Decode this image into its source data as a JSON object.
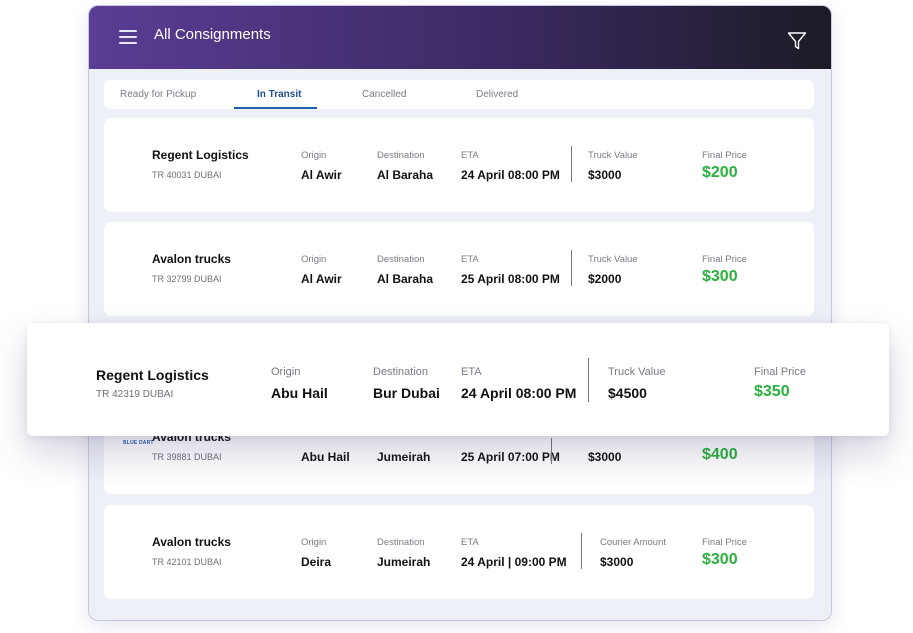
{
  "header": {
    "title": "All Consignments"
  },
  "tabs": [
    "Ready for Pickup",
    "In Transit",
    "Cancelled",
    "Delivered"
  ],
  "active_tab": "In Transit",
  "cards": [
    {
      "company": "Regent Logistics",
      "sub": "TR 40031 DUBAI",
      "origin_label": "Origin",
      "origin": "Al Awir",
      "dest_label": "Destination",
      "dest": "Al Baraha",
      "eta_label": "ETA",
      "eta": "24 April 08:00 PM",
      "amount_label": "Truck Value",
      "amount": "$3000",
      "price_label": "Final Price",
      "price": "$200"
    },
    {
      "company": "Avalon trucks",
      "sub": "TR 32799 DUBAI",
      "origin_label": "Origin",
      "origin": "Al Awir",
      "dest_label": "Destination",
      "dest": "Al Baraha",
      "eta_label": "ETA",
      "eta": "25 April 08:00 PM",
      "amount_label": "Truck Value",
      "amount": "$2000",
      "price_label": "Final Price",
      "price": "$300"
    },
    {
      "company": "Avalon trucks",
      "sub": "TR 39881 DUBAI",
      "logo": "BLUE DART",
      "origin": "Abu Hail",
      "dest": "Jumeirah",
      "eta": "25 April 07:00 PM",
      "amount": "$3000",
      "price": "$400"
    },
    {
      "company": "Avalon trucks",
      "sub": "TR 42101 DUBAI",
      "origin_label": "Origin",
      "origin": "Deira",
      "dest_label": "Destination",
      "dest": "Jumeirah",
      "eta_label": "ETA",
      "eta": "24 April | 09:00 PM",
      "amount_label": "Courier Amount",
      "amount": "$3000",
      "price_label": "Final Price",
      "price": "$300"
    }
  ],
  "highlight": {
    "company": "Regent Logistics",
    "sub": "TR 42319 DUBAI",
    "origin_label": "Origin",
    "origin": "Abu Hail",
    "dest_label": "Destination",
    "dest": "Bur Dubai",
    "eta_label": "ETA",
    "eta": "24 April 08:00 PM",
    "amount_label": "Truck Value",
    "amount": "$4500",
    "price_label": "Final Price",
    "price": "$350"
  },
  "colors": {
    "header_start": "#5a3d95",
    "header_end": "#1c1b26",
    "price_green": "#2bb13d",
    "active_tab": "#1f4e8c"
  },
  "icons": {
    "menu": "hamburger-icon",
    "filter": "filter-icon"
  }
}
